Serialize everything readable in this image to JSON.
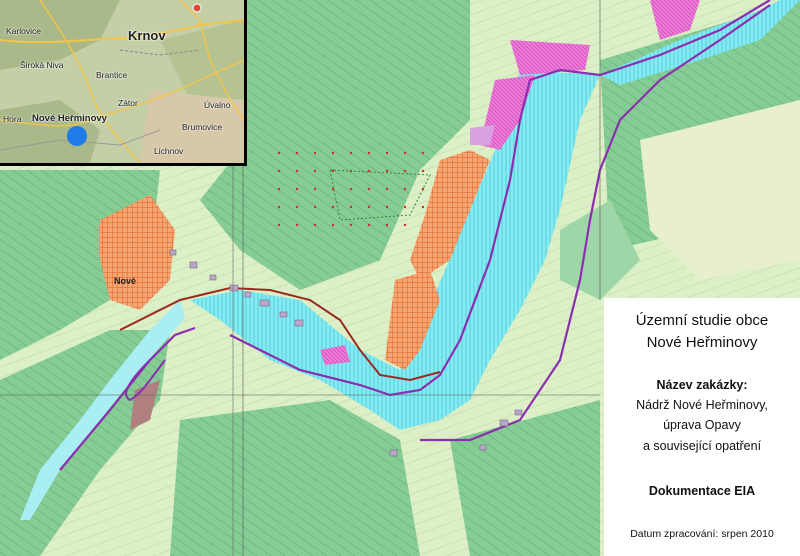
{
  "inset_map": {
    "places": {
      "karlovice": "Karlovice",
      "krnov": "Krnov",
      "siroka_niva": "Široká Niva",
      "brantice": "Brantice",
      "zator": "Zátor",
      "uvalno": "Úvalno",
      "hora": "Hora",
      "nove_herminovy": "Nové Heřminovy",
      "brumovice": "Brumovice",
      "lichnov": "Lichnov"
    }
  },
  "main_map": {
    "village_label": "Nové"
  },
  "title_block": {
    "line1": "Územní studie obce",
    "line2": "Nové Heřminovy",
    "contract_heading": "Název zakázky:",
    "contract_line1": "Nádrž Nové Heřminovy,",
    "contract_line2": "úprava Opavy",
    "contract_line3": "a související opatření",
    "document": "Dokumentace EIA",
    "date": "Datum zpracování: srpen 2010"
  },
  "colors": {
    "forest": "#7cc78e",
    "meadow": "#d6ecc0",
    "reservoir": "#7fe9f0",
    "orange_zone": "#f28a3c",
    "magenta_zone": "#e85ad0",
    "road_purple": "#8a2fb0",
    "rail_red": "#b0201a",
    "location_marker": "#1f7be6"
  }
}
